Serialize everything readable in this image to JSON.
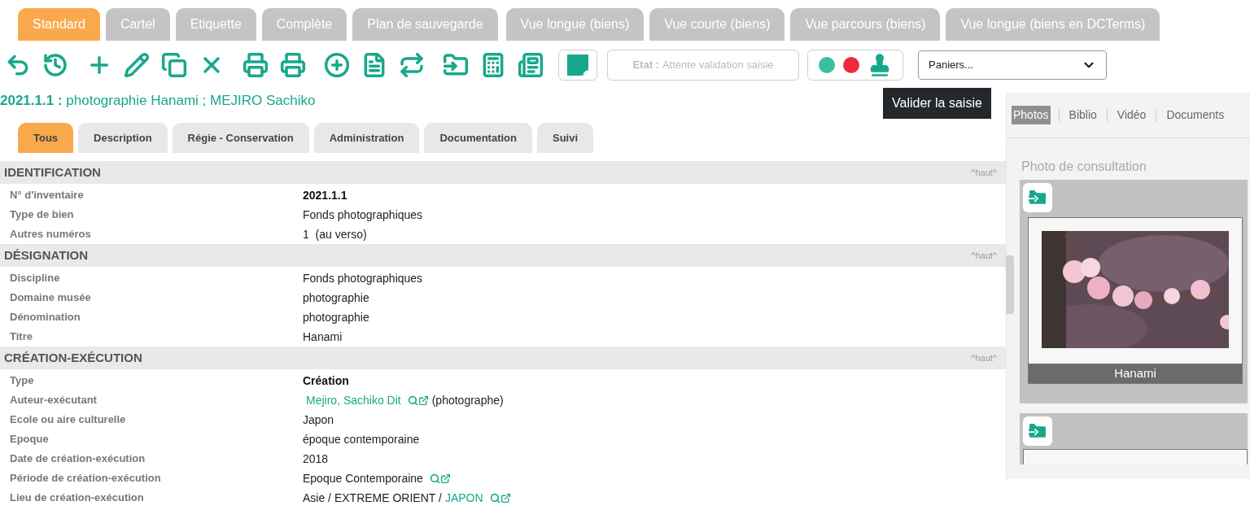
{
  "view_tabs": [
    {
      "label": "Standard",
      "selected": true
    },
    {
      "label": "Cartel",
      "selected": false
    },
    {
      "label": "Etiquette",
      "selected": false
    },
    {
      "label": "Complète",
      "selected": false
    },
    {
      "label": "Plan de sauvegarde",
      "selected": false
    },
    {
      "label": "Vue longue (biens)",
      "selected": false
    },
    {
      "label": "Vue courte (biens)",
      "selected": false
    },
    {
      "label": "Vue parcours (biens)",
      "selected": false
    },
    {
      "label": "Vue longue (biens en DCTerms)",
      "selected": false
    }
  ],
  "toolbar": {
    "state_field": {
      "label": "Etat :",
      "value": "Attente validation saisie"
    },
    "tooltip": "Valider la saisie",
    "basket_select": {
      "value": "Paniers..."
    }
  },
  "record_title": {
    "number": "2021.1.1 :",
    "text": "photographie Hanami ; MEJIRO Sachiko"
  },
  "section_tabs": [
    {
      "label": "Tous",
      "selected": true
    },
    {
      "label": "Description",
      "selected": false
    },
    {
      "label": "Régie - Conservation",
      "selected": false
    },
    {
      "label": "Administration",
      "selected": false
    },
    {
      "label": "Documentation",
      "selected": false
    },
    {
      "label": "Suivi",
      "selected": false
    }
  ],
  "sections": [
    {
      "title": "IDENTIFICATION",
      "top_link": "^haut^",
      "rows": [
        {
          "label": "N° d'inventaire",
          "value": [
            {
              "kind": "bold",
              "text": "2021.1.1"
            }
          ]
        },
        {
          "label": "Type de bien",
          "value": [
            {
              "kind": "text",
              "text": "Fonds photographiques"
            }
          ]
        },
        {
          "label": "Autres numéros",
          "value": [
            {
              "kind": "text",
              "text": "1  (au verso)"
            }
          ]
        }
      ]
    },
    {
      "title": "DÉSIGNATION",
      "top_link": "^haut^",
      "rows": [
        {
          "label": "Discipline",
          "value": [
            {
              "kind": "text",
              "text": "Fonds photographiques"
            }
          ]
        },
        {
          "label": "Domaine musée",
          "value": [
            {
              "kind": "text",
              "text": "photographie"
            }
          ]
        },
        {
          "label": "Dénomination",
          "value": [
            {
              "kind": "text",
              "text": "photographie"
            }
          ]
        },
        {
          "label": "Titre",
          "value": [
            {
              "kind": "text",
              "text": "Hanami"
            }
          ]
        }
      ]
    },
    {
      "title": "CRÉATION-EXÉCUTION",
      "top_link": "^haut^",
      "rows": [
        {
          "label": "Type",
          "value": [
            {
              "kind": "bold",
              "text": "Création"
            }
          ]
        },
        {
          "label": "Auteur-exécutant",
          "value": [
            {
              "kind": "link",
              "text": "Mejiro, Sachiko Dit"
            },
            {
              "kind": "lookup"
            },
            {
              "kind": "text",
              "text": "(photographe)"
            }
          ]
        },
        {
          "label": "Ecole ou aire culturelle",
          "value": [
            {
              "kind": "text",
              "text": "Japon"
            }
          ]
        },
        {
          "label": "Epoque",
          "value": [
            {
              "kind": "text",
              "text": "époque contemporaine"
            }
          ]
        },
        {
          "label": "Date de création-exécution",
          "value": [
            {
              "kind": "text",
              "text": "2018"
            }
          ]
        },
        {
          "label": "Période de création-exécution",
          "value": [
            {
              "kind": "text",
              "text": "Epoque Contemporaine"
            },
            {
              "kind": "lookup"
            }
          ]
        },
        {
          "label": "Lieu de création-exécution",
          "value": [
            {
              "kind": "text",
              "text": "Asie / EXTREME ORIENT /"
            },
            {
              "kind": "link",
              "text": "JAPON"
            },
            {
              "kind": "lookup"
            }
          ]
        }
      ]
    }
  ],
  "media_panel": {
    "tabs": [
      {
        "label": "Photos",
        "selected": true
      },
      {
        "label": "Biblio",
        "selected": false
      },
      {
        "label": "Vidéo",
        "selected": false
      },
      {
        "label": "Documents",
        "selected": false
      }
    ],
    "heading": "Photo de consultation",
    "cards": [
      {
        "caption": "Hanami",
        "kind": "picture"
      },
      {
        "kind": "empty"
      }
    ]
  }
}
